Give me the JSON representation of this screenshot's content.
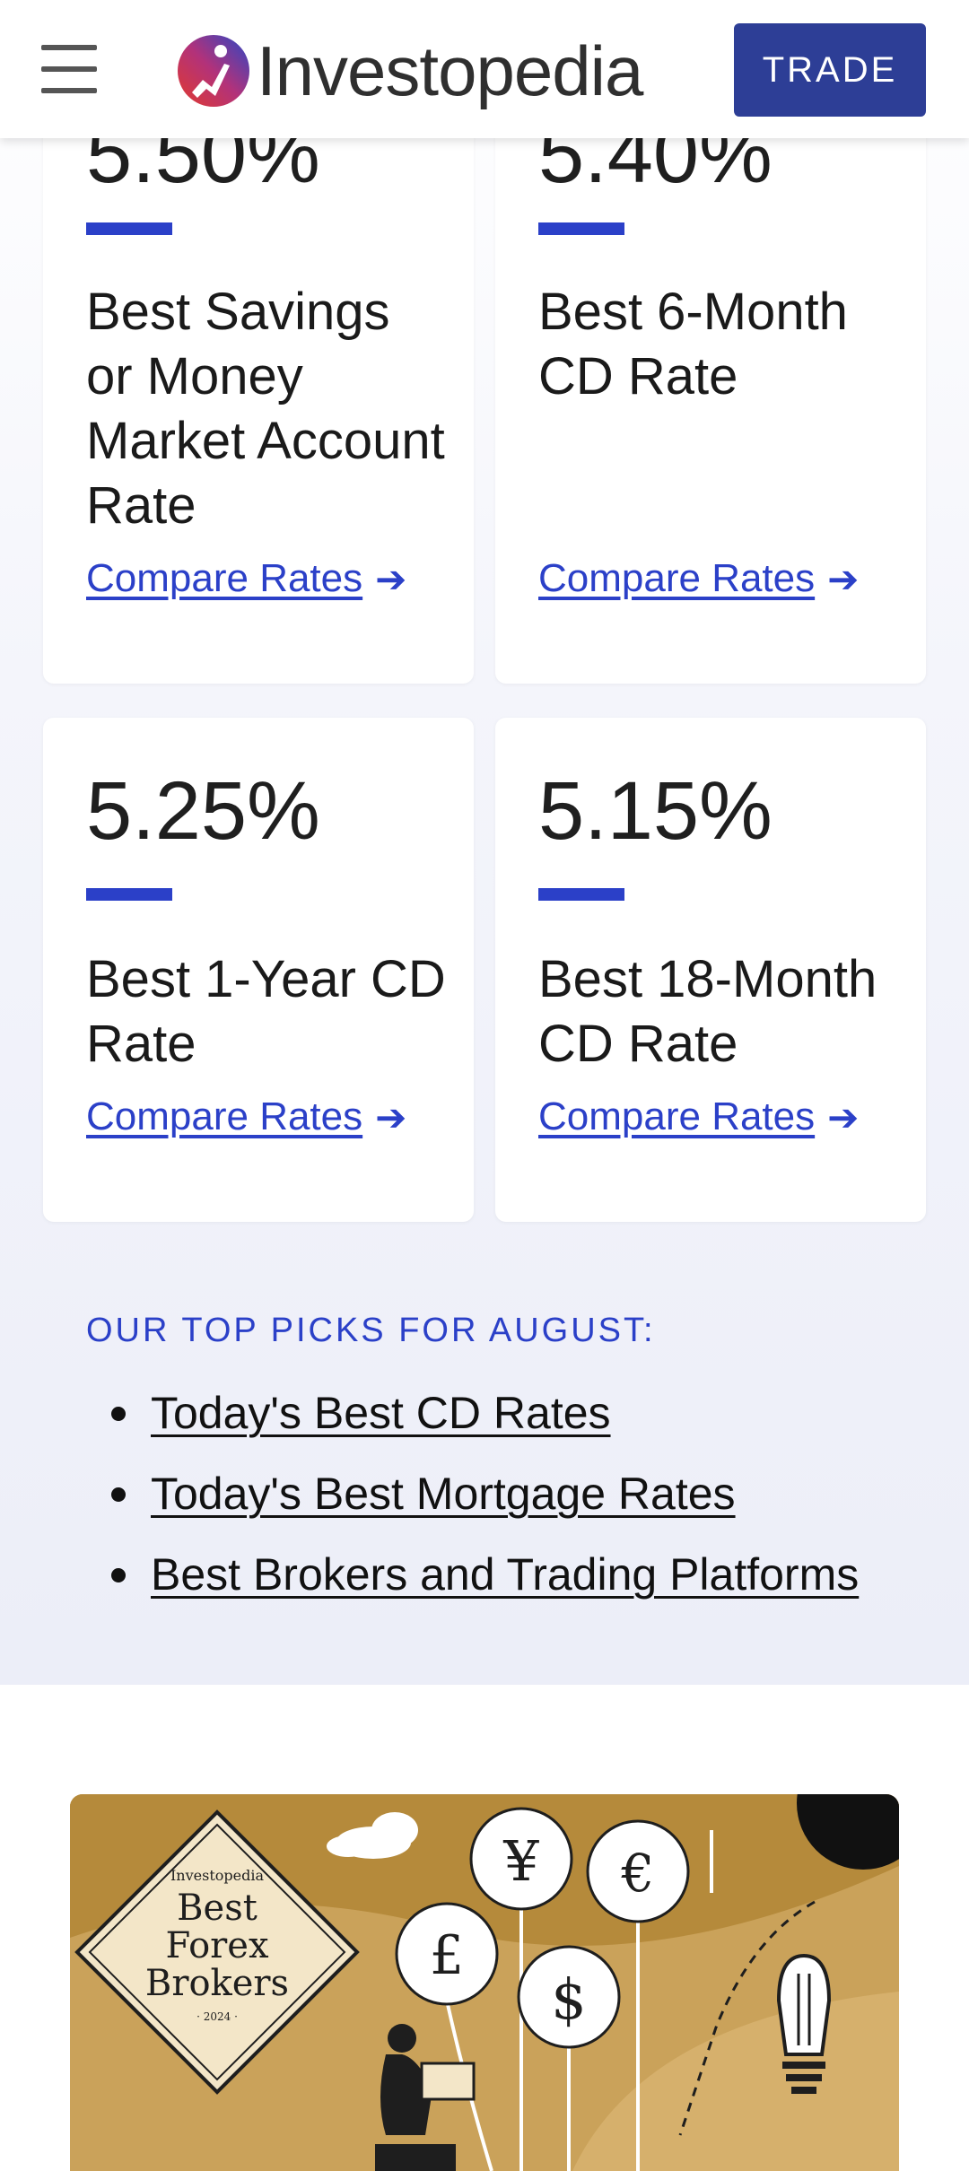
{
  "header": {
    "brand": "Investopedia",
    "trade_label": "TRADE",
    "menu_icon": "hamburger-menu-icon"
  },
  "cards": [
    {
      "rate": "5.50%",
      "title": "Best Savings or Money Market Account Rate",
      "link": "Compare Rates"
    },
    {
      "rate": "5.40%",
      "title": "Best 6-Month CD Rate",
      "link": "Compare Rates"
    },
    {
      "rate": "5.25%",
      "title": "Best 1-Year CD Rate",
      "link": "Compare Rates"
    },
    {
      "rate": "5.15%",
      "title": "Best 18-Month CD Rate",
      "link": "Compare Rates"
    }
  ],
  "top_picks": {
    "heading": "OUR TOP PICKS FOR AUGUST:",
    "items": [
      "Today's Best CD Rates",
      "Today's Best Mortgage Rates",
      "Best Brokers and Trading Platforms"
    ]
  },
  "ad": {
    "badge_brand": "Investopedia",
    "badge_line1": "Best",
    "badge_line2": "Forex",
    "badge_line3": "Brokers",
    "badge_year": "· 2024 ·",
    "currency_symbols": [
      "¥",
      "€",
      "£",
      "$"
    ]
  },
  "colors": {
    "accent": "#2b40c8",
    "trade_button": "#2d3e96",
    "ad_background": "#b58a3b"
  }
}
